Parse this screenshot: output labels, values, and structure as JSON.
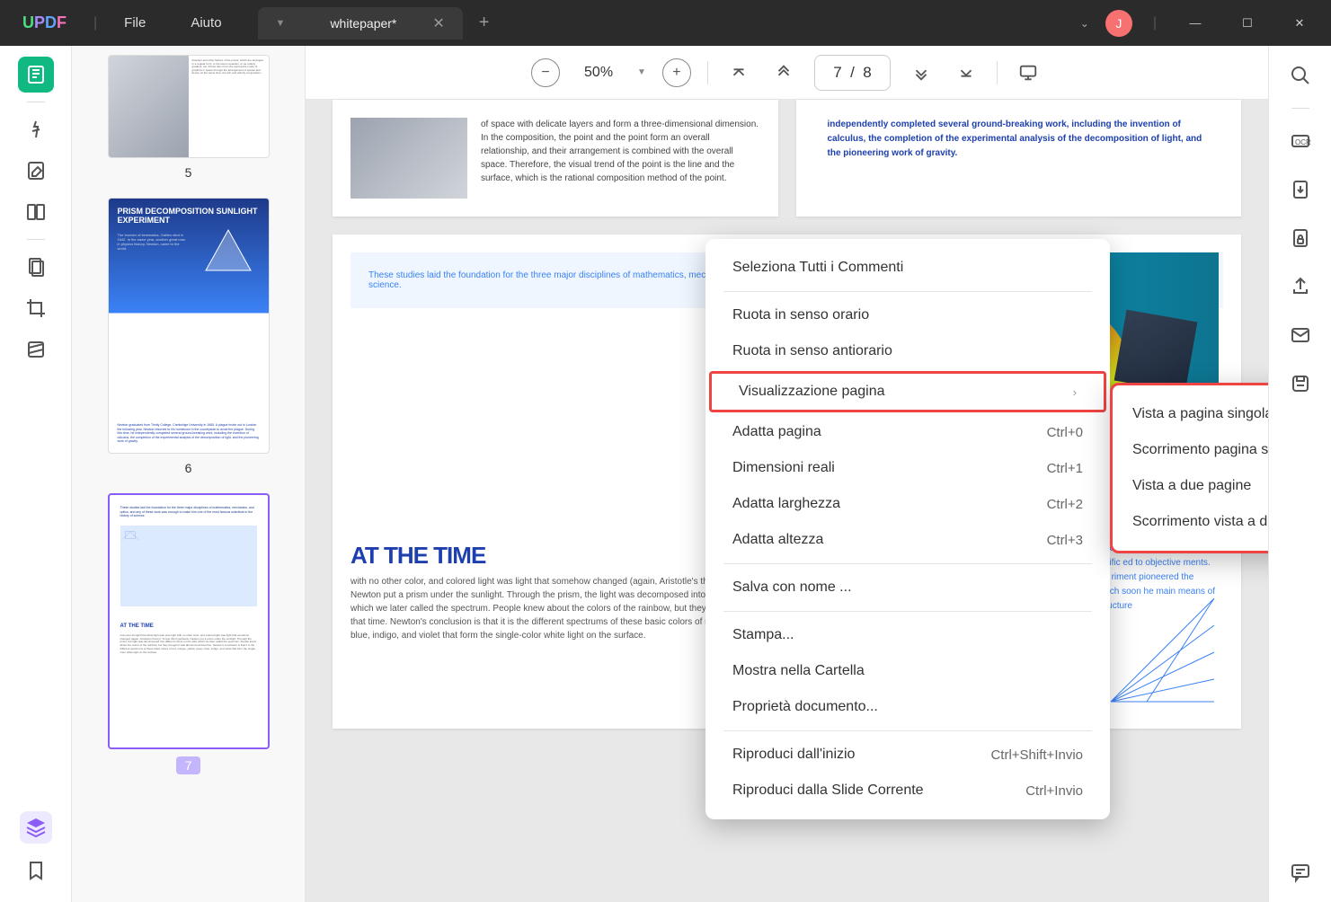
{
  "app": {
    "logo": "UPDF"
  },
  "menu": {
    "file": "File",
    "help": "Aiuto"
  },
  "tab": {
    "title": "whitepaper*"
  },
  "avatar": {
    "initial": "J"
  },
  "toolbar": {
    "zoom": "50%",
    "page_indicator": "7  /  8"
  },
  "thumbs": {
    "p5": "5",
    "p6": "6",
    "p7": "7",
    "t6_title": "PRISM DECOMPOSITION SUNLIGHT EXPERIMENT",
    "t6_sub": "The founder of kinematics, Galileo died in 1642. In the same year, another great man in physics history, Newton, came to the world.",
    "t6_body": "Newton graduated from Trinity College, Cambridge University in 1665. A plague broke out in London the following year. Newton returned to his hometown in the countryside to avoid the plague. During this time, he independently completed several ground-breaking work, including the invention of calculus, the completion of the experimental analysis of the decomposition of light, and the pioneering work of gravity.",
    "t7_top": "These studies laid the foundation for the three major disciplines of mathematics, mechanics, and optics, and any of these work was enough to make him one of the most famous scientists in the history of science.",
    "t7_h": "AT THE TIME",
    "t7_body": "everyone thought that white light was pure light with no other color, and colored light was light that somehow changed (again, Aristotle's theory). To test this hypothesis, Newton put a prism under the sunlight. Through the prism, the light was decomposed into different colors on the wall, which we later called the spectrum. People knew about the colors of the rainbow, but they thought it was abnormal at that time. Newton's conclusion is that it is the different spectrums of these basic colors of red, orange, yellow, green, blue, indigo, and violet that form the single-color white light on the surface."
  },
  "pages": {
    "top_left_text": "of space with delicate layers and form a three-dimensional dimension. In the composition, the point and the point form an overall relationship, and their arrangement is combined with the overall space. Therefore, the visual trend of the point is the line and the surface, which is the rational composition method of the point.",
    "top_right_text": "independently completed several ground-breaking work, including the invention of calculus, the completion of the experimental analysis of the decomposition of light, and the pioneering work of gravity.",
    "p2_box": "These studies laid the foundation for the three major disciplines of mathematics, mechanics, and optics, and any of these work was enough to make him one of the most famous scientists in the history of science.",
    "p2_h": "AT THE TIME",
    "p2_body": "with no other color, and colored light was light that somehow changed (again, Aristotle's theory). To test this hypothesis, Newton put a prism under the sunlight. Through the prism, the light was decomposed into different colors on the wall, which we later called the spectrum. People knew about the colors of the rainbow, but they thought it was abnormal at that time. Newton's conclusion is that it is the different spectrums of these basic colors of red, orange, yellow, green, blue, indigo, and violet that form the single-color white light on the surface.",
    "p2_side": "this experiment, Newton oundation for the theory sion of light, and made interpretation of color free jective visual impressions, arking on a scientific ed to objective ments. At the same time, riment pioneered the spectroscopy, which soon he main means of optics and the structure"
  },
  "context_menu": {
    "select_all": "Seleziona Tutti i Commenti",
    "rotate_cw": "Ruota in senso orario",
    "rotate_ccw": "Ruota in senso antiorario",
    "page_view": "Visualizzazione pagina",
    "fit_page": "Adatta pagina",
    "actual_size": "Dimensioni reali",
    "fit_width": "Adatta larghezza",
    "fit_height": "Adatta altezza",
    "save_as": "Salva con nome ...",
    "print": "Stampa...",
    "show_folder": "Mostra nella Cartella",
    "doc_props": "Proprietà documento...",
    "play_start": "Riproduci dall'inizio",
    "play_current": "Riproduci dalla Slide Corrente",
    "sc_fit_page": "Ctrl+0",
    "sc_actual": "Ctrl+1",
    "sc_width": "Ctrl+2",
    "sc_height": "Ctrl+3",
    "sc_play_start": "Ctrl+Shift+Invio",
    "sc_play_current": "Ctrl+Invio"
  },
  "submenu": {
    "single": "Vista a pagina singola",
    "single_scroll": "Scorrimento pagina singola",
    "two": "Vista a due pagine",
    "two_scroll": "Scorrimento vista a due pagine"
  }
}
